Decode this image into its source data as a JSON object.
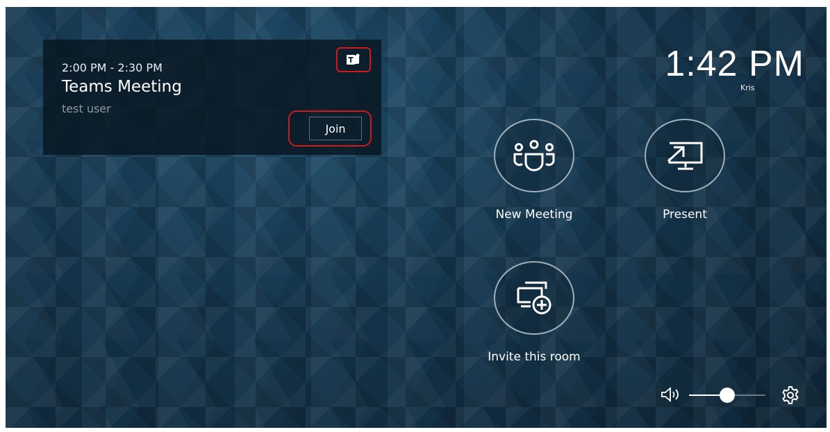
{
  "meeting": {
    "time": "2:00 PM - 2:30 PM",
    "title": "Teams Meeting",
    "organizer": "test user",
    "join_label": "Join",
    "provider_icon": "teams-icon"
  },
  "header": {
    "clock": "1:42 PM",
    "room_name": "Kris"
  },
  "actions": [
    {
      "label": "New Meeting",
      "icon": "people-icon"
    },
    {
      "label": "Present",
      "icon": "screen-share-icon"
    },
    {
      "label": "Invite this room",
      "icon": "add-display-icon"
    }
  ],
  "controls": {
    "volume_level": 0.5,
    "volume_icon": "speaker-icon",
    "settings_icon": "gear-icon"
  },
  "colors": {
    "highlight": "#d01a1a",
    "background": "#163850"
  }
}
